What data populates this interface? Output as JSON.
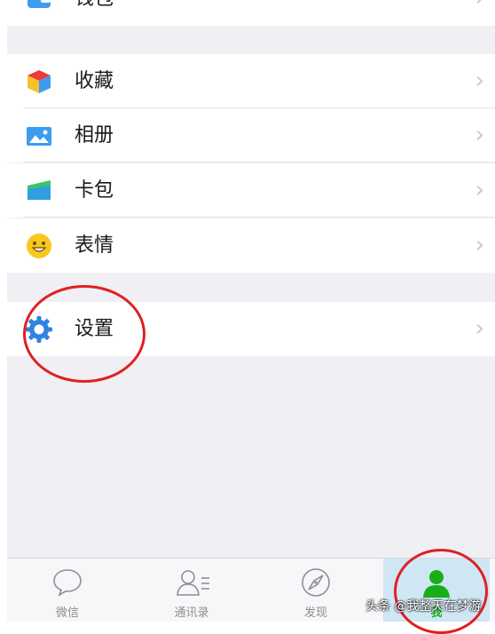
{
  "menu": {
    "wallet": "钱包",
    "favorites": "收藏",
    "album": "相册",
    "cards": "卡包",
    "stickers": "表情",
    "settings": "设置"
  },
  "tabs": [
    {
      "label": "微信"
    },
    {
      "label": "通讯录"
    },
    {
      "label": "发现"
    },
    {
      "label": "我"
    }
  ],
  "watermark": "头条 @我整天在梦游",
  "colors": {
    "wechat_green": "#1aad19",
    "annotation_red": "#e02020",
    "settings_blue": "#2f82e0"
  }
}
